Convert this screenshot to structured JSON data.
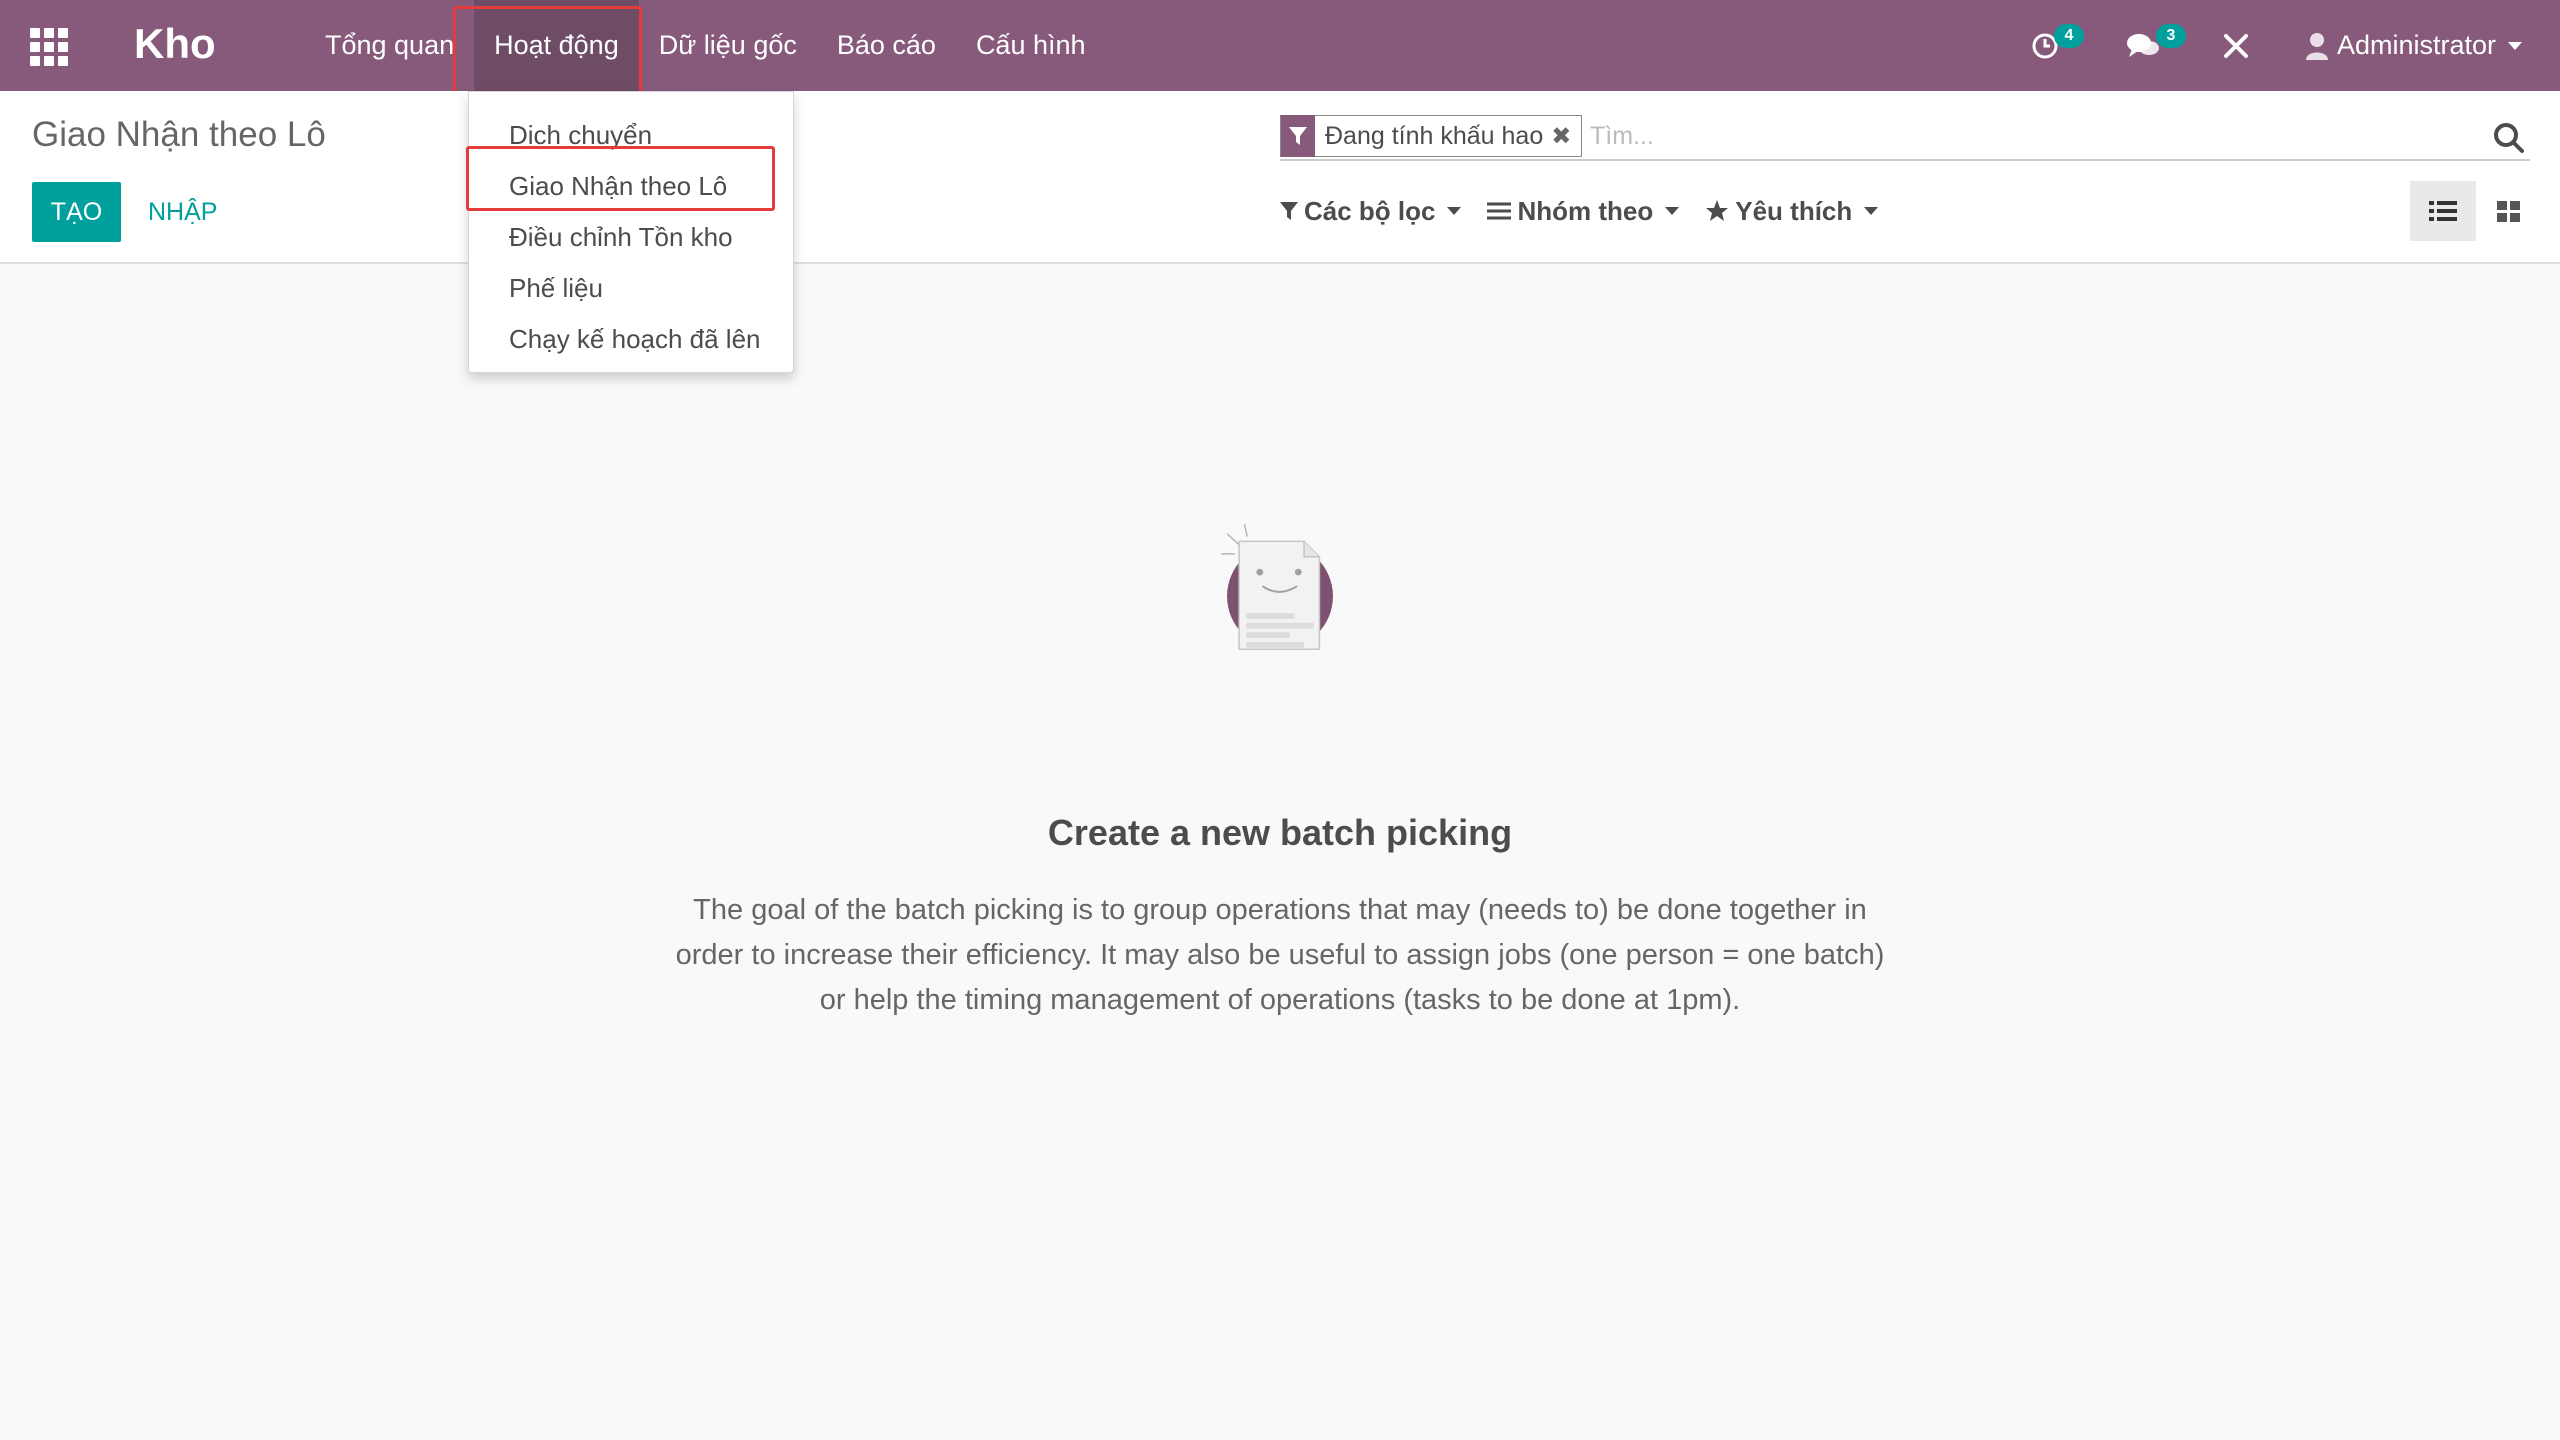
{
  "navbar": {
    "brand": "Kho",
    "menu": [
      {
        "label": "Tổng quan"
      },
      {
        "label": "Hoạt động"
      },
      {
        "label": "Dữ liệu gốc"
      },
      {
        "label": "Báo cáo"
      },
      {
        "label": "Cấu hình"
      }
    ],
    "activity_count": "4",
    "messages_count": "3",
    "user": "Administrator",
    "color": "#875a7b"
  },
  "dropdown": {
    "items": [
      {
        "label": "Dịch chuyển"
      },
      {
        "label": "Giao Nhận theo Lô"
      },
      {
        "label": "Điều chỉnh Tồn kho"
      },
      {
        "label": "Phế liệu"
      },
      {
        "label": "Chạy kế hoạch đã lên"
      }
    ]
  },
  "control": {
    "breadcrumb": "Giao Nhận theo Lô",
    "create_label": "TẠO",
    "import_label": "NHẬP",
    "facet": "Đang tính khấu hao",
    "search_placeholder": "Tìm...",
    "filters_label": "Các bộ lọc",
    "group_label": "Nhóm theo",
    "favorites_label": "Yêu thích"
  },
  "empty": {
    "title": "Create a new batch picking",
    "text": "The goal of the batch picking is to group operations that may (needs to) be done together in order to increase their efficiency. It may also be useful to assign jobs (one person = one batch) or help the timing management of operations (tasks to be done at 1pm)."
  },
  "colors": {
    "accent": "#00a09d",
    "brand": "#875a7b",
    "highlight": "#e43b3b"
  }
}
